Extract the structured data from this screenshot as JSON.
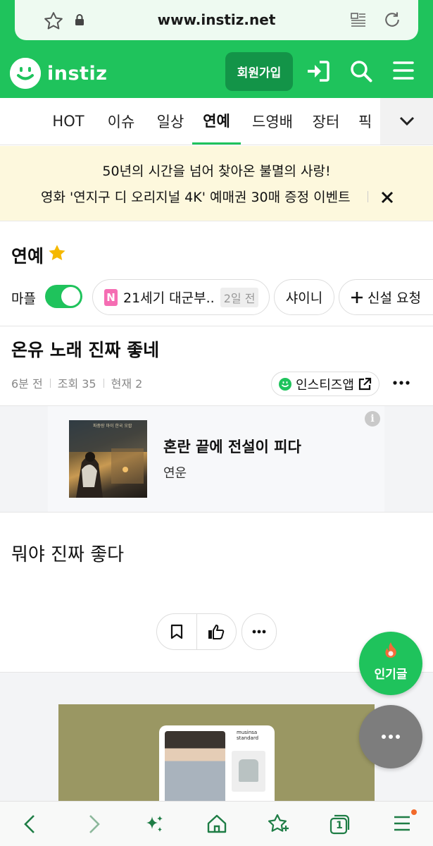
{
  "browser": {
    "url": "www.instiz.net"
  },
  "header": {
    "logo_text": "instiz",
    "join_label": "회원가입"
  },
  "tabs": [
    {
      "label": "HOT",
      "active": false
    },
    {
      "label": "이슈",
      "active": false
    },
    {
      "label": "일상",
      "active": false
    },
    {
      "label": "연예",
      "active": true
    },
    {
      "label": "드영배",
      "active": false
    },
    {
      "label": "장터",
      "active": false
    },
    {
      "label": "픽",
      "active": false
    }
  ],
  "banner": {
    "line1": "50년의 시간을 넘어 찾아온 불멸의 사랑!",
    "line2": "영화 '연지구 디 오리지널 4K' 예매권 30매 증정 이벤트"
  },
  "board": {
    "title": "연예",
    "maple_label": "마플",
    "maple_toggle_on": true,
    "chips": [
      {
        "badge": "N",
        "label": "21세기 대군부..",
        "time": "2일 전"
      },
      {
        "label": "샤이니"
      },
      {
        "label": "신설 요청"
      }
    ]
  },
  "post": {
    "title": "온유 노래 진짜 좋네",
    "time": "6분 전",
    "views": "조회 35",
    "current": "현재 2",
    "app_button": "인스티즈앱",
    "body": "뭐야 진짜 좋다"
  },
  "ad": {
    "title": "혼란 끝에 전설이 피다",
    "subtitle": "연운",
    "info": "i",
    "image_caption": "파중랑 마이 한국 오랍"
  },
  "shop_ad": {
    "brand": "musinsa standard"
  },
  "fab": {
    "hot_label": "인기글"
  },
  "bottom_bar": {
    "tab_count": "1"
  },
  "colors": {
    "brand_green": "#1fc35c",
    "dark_green": "#139448",
    "banner_bg": "#fdf8dd"
  }
}
